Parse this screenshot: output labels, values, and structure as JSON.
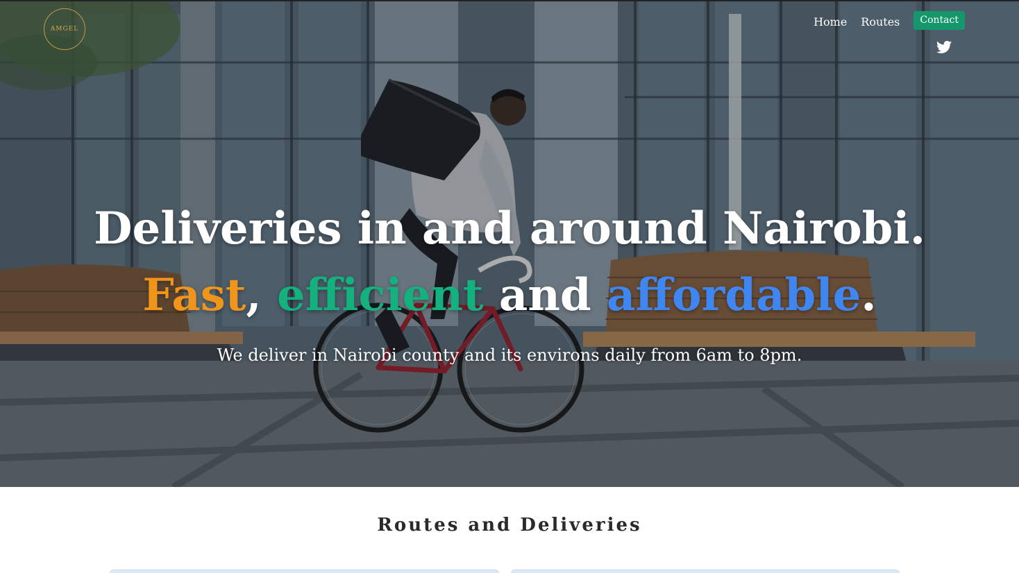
{
  "brand": {
    "logo_text": "AMGEL"
  },
  "nav": {
    "home": "Home",
    "routes": "Routes",
    "contact": "Contact",
    "social": "twitter-icon"
  },
  "hero": {
    "line1": "Deliveries in and around Nairobi.",
    "fast": "Fast",
    "comma": ", ",
    "efficient": "efficient",
    "and": " and ",
    "affordable": "affordable",
    "period": ".",
    "subtitle": "We deliver in Nairobi county and its environs daily from 6am to 8pm."
  },
  "section": {
    "title": "Routes and Deliveries"
  },
  "colors": {
    "fast": "#f0951c",
    "efficient": "#14b07e",
    "affordable": "#3f86f0",
    "contact_button": "#15966b",
    "logo": "#d3a94f"
  }
}
